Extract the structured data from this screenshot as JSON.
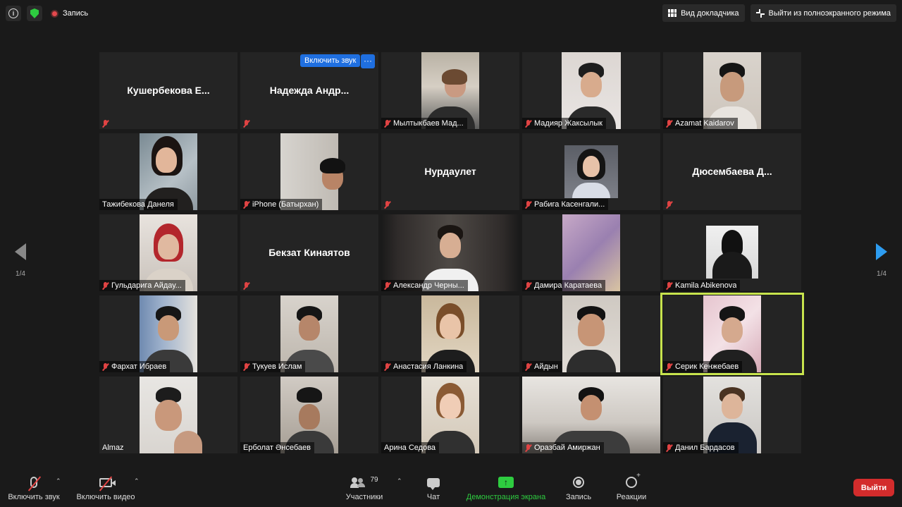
{
  "top_bar": {
    "recording_label": "Запись",
    "speaker_view_label": "Вид докладчика",
    "exit_fullscreen_label": "Выйти из полноэкранного режима"
  },
  "nav": {
    "page_left": "1/4",
    "page_right": "1/4"
  },
  "tile_overlay": {
    "unmute_label": "Включить звук",
    "more_label": "···"
  },
  "participants": [
    {
      "name": "Кушербекова  Е...",
      "video": false,
      "muted": true
    },
    {
      "name": "Надежда  Андр...",
      "video": false,
      "muted": true
    },
    {
      "name": "Мылтыкбаев Мад...",
      "video": true,
      "muted": true
    },
    {
      "name": "Мадияр Жаксылык",
      "video": true,
      "muted": true
    },
    {
      "name": "Azamat Kaidarov",
      "video": true,
      "muted": true
    },
    {
      "name": "Тажибекова Данеля",
      "video": true,
      "muted": false
    },
    {
      "name": "iPhone (Батырхан)",
      "video": true,
      "muted": true
    },
    {
      "name": "Нурдаулет",
      "video": false,
      "muted": true
    },
    {
      "name": "Рабига Касенгали...",
      "video": true,
      "muted": true
    },
    {
      "name": "Дюсембаева  Д...",
      "video": false,
      "muted": true
    },
    {
      "name": "Гульдарига Айдау...",
      "video": true,
      "muted": true
    },
    {
      "name": "Бекзат Кинаятов",
      "video": false,
      "muted": true
    },
    {
      "name": "Александр Черны...",
      "video": true,
      "muted": true
    },
    {
      "name": "Дамира Каратаева",
      "video": true,
      "muted": true
    },
    {
      "name": "Kamila Abikenova",
      "video": true,
      "muted": true
    },
    {
      "name": "Фархат Ибраев",
      "video": true,
      "muted": true
    },
    {
      "name": "Тукуев Ислам",
      "video": true,
      "muted": true
    },
    {
      "name": "Анастасия Ланкина",
      "video": true,
      "muted": true
    },
    {
      "name": "Айдын",
      "video": true,
      "muted": true
    },
    {
      "name": "Серик Кенжебаев",
      "video": true,
      "muted": true,
      "active_speaker": true
    },
    {
      "name": "Almaz",
      "video": true,
      "muted": false
    },
    {
      "name": "Ерболат Әнсебаев",
      "video": true,
      "muted": false
    },
    {
      "name": "Арина Седова",
      "video": true,
      "muted": false
    },
    {
      "name": "Оразбай Амиржан",
      "video": true,
      "muted": true
    },
    {
      "name": "Данил Бардасов",
      "video": true,
      "muted": true
    }
  ],
  "toolbar": {
    "unmute_label": "Включить звук",
    "start_video_label": "Включить видео",
    "participants_label": "Участники",
    "participants_count": "79",
    "chat_label": "Чат",
    "share_label": "Демонстрация экрана",
    "record_label": "Запись",
    "reactions_label": "Реакции",
    "leave_label": "Выйти",
    "caret": "⌃"
  },
  "colors": {
    "active_border": "#c7e34d",
    "leave": "#d32c2c",
    "share": "#2ecc40",
    "unmute_badge": "#1f6fe0",
    "muted_icon": "#e04343"
  }
}
